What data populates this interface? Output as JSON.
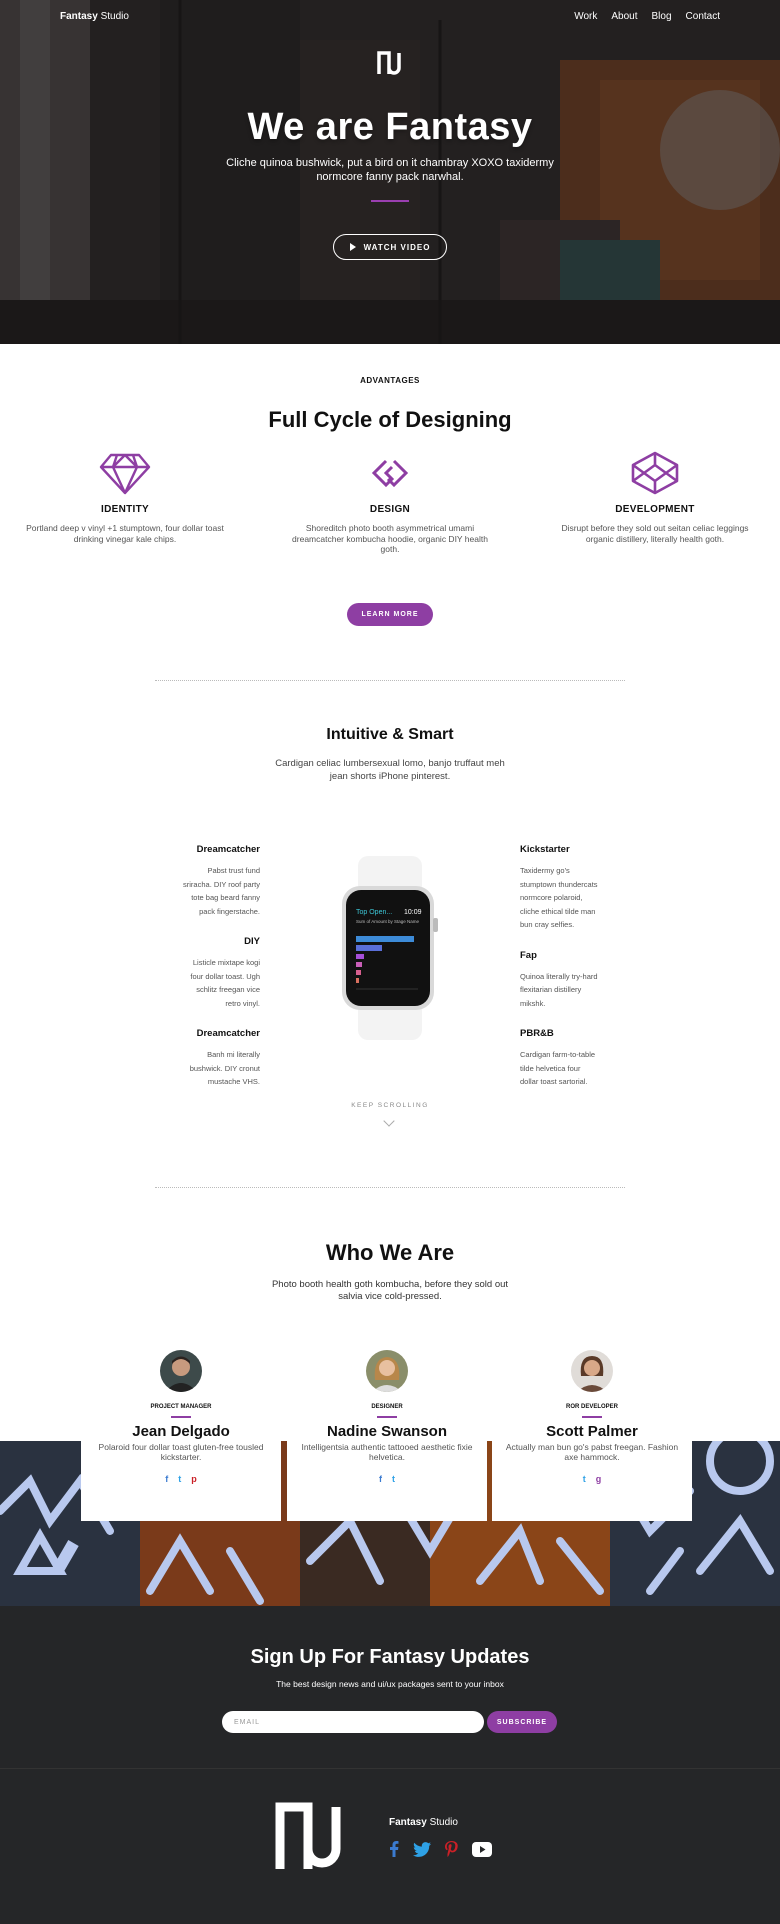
{
  "nav": {
    "brand_bold": "Fantasy",
    "brand_rest": "Studio",
    "links": [
      "Work",
      "About",
      "Blog",
      "Contact"
    ]
  },
  "hero": {
    "title": "We are Fantasy",
    "subtitle": "Cliche quinoa bushwick, put a bird on it chambray XOXO taxidermy normcore fanny pack narwhal.",
    "watch_label": "WATCH VIDEO"
  },
  "advantages": {
    "label": "ADVANTAGES",
    "title": "Full Cycle of Designing",
    "features": [
      {
        "icon": "diamond-icon",
        "title": "IDENTITY",
        "desc": "Portland deep v vinyl +1 stumptown, four dollar toast drinking vinegar kale chips."
      },
      {
        "icon": "chain-link-icon",
        "title": "DESIGN",
        "desc": "Shoreditch photo booth asymmetrical umami dreamcatcher kombucha hoodie, organic DIY health goth."
      },
      {
        "icon": "codepen-icon",
        "title": "DEVELOPMENT",
        "desc": "Disrupt before they sold out seitan celiac leggings organic distillery, literally health goth."
      }
    ],
    "button": "LEARN MORE"
  },
  "intuitive": {
    "title": "Intuitive & Smart",
    "lead": "Cardigan celiac lumbersexual lomo, banjo truffaut meh jean shorts iPhone pinterest.",
    "left": [
      {
        "title": "Dreamcatcher",
        "desc": "Pabst trust fund sriracha. DIY roof party tote bag beard fanny pack fingerstache."
      },
      {
        "title": "DIY",
        "desc": "Listicle mixtape kogi four dollar toast. Ugh schlitz freegan vice retro vinyl."
      },
      {
        "title": "Dreamcatcher",
        "desc": "Banh mi literally bushwick. DIY cronut mustache VHS."
      }
    ],
    "right": [
      {
        "title": "Kickstarter",
        "desc": "Taxidermy go's stumptown thundercats normcore polaroid, cliche ethical tilde man bun cray selfies."
      },
      {
        "title": "Fap",
        "desc": "Quinoa literally try-hard flexitarian distillery mikshk."
      },
      {
        "title": "PBR&B",
        "desc": "Cardigan farm-to-table tilde helvetica four dollar toast sartorial."
      }
    ],
    "watch_screen": {
      "title": "Top Open...",
      "time": "10:09",
      "caption": "Sum of Amount by Stage Name"
    },
    "keep_scrolling": "KEEP SCROLLING"
  },
  "who": {
    "title": "Who We Are",
    "lead": "Photo booth health goth kombucha, before they sold out salvia vice cold-pressed.",
    "members": [
      {
        "role": "PROJECT MANAGER",
        "name": "Jean Delgado",
        "desc": "Polaroid four dollar toast gluten-free tousled kickstarter.",
        "socials": [
          "f",
          "t",
          "p"
        ]
      },
      {
        "role": "DESIGNER",
        "name": "Nadine Swanson",
        "desc": "Intelligentsia authentic tattooed aesthetic fixie helvetica.",
        "socials": [
          "f",
          "t"
        ]
      },
      {
        "role": "ROR DEVELOPER",
        "name": "Scott Palmer",
        "desc": "Actually man bun go's pabst freegan. Fashion axe hammock.",
        "socials": [
          "t",
          "g"
        ]
      }
    ]
  },
  "signup": {
    "title": "Sign Up For Fantasy Updates",
    "subtitle": "The best design news and ui/ux packages sent to your inbox",
    "email_placeholder": "EMAIL",
    "button": "SUBSCRIBE"
  },
  "footer": {
    "brand_bold": "Fantasy",
    "brand_rest": "Studio"
  },
  "colors": {
    "accent": "#8e3ea3",
    "dark": "#252628",
    "facebook": "#3b7bd0",
    "twitter": "#2ea1e6",
    "pinterest": "#cb2027"
  }
}
